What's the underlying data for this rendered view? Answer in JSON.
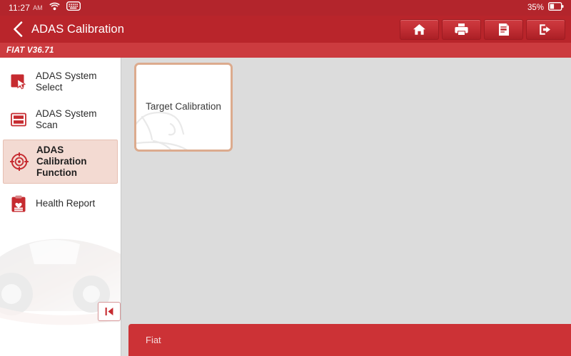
{
  "statusbar": {
    "time": "11:27",
    "ampm": "AM",
    "wifi_icon": "wifi-icon",
    "keyboard_icon": "keyboard-icon",
    "battery_percent": "35%",
    "battery_icon": "battery-icon"
  },
  "header": {
    "back_icon": "back-chevron-icon",
    "title": "ADAS Calibration",
    "toolbar": [
      {
        "name": "home-button",
        "icon": "home-icon"
      },
      {
        "name": "print-button",
        "icon": "printer-icon"
      },
      {
        "name": "adas-report-button",
        "icon": "adas-report-icon"
      },
      {
        "name": "exit-button",
        "icon": "exit-icon"
      }
    ]
  },
  "subbar": {
    "version_text": "FIAT V36.71"
  },
  "sidebar": {
    "items": [
      {
        "label": "ADAS System Select",
        "icon": "cursor-select-icon",
        "selected": false
      },
      {
        "label": "ADAS System Scan",
        "icon": "scan-layers-icon",
        "selected": false
      },
      {
        "label": "ADAS Calibration Function",
        "icon": "target-crosshair-icon",
        "selected": true
      },
      {
        "label": "Health Report",
        "icon": "clipboard-heart-icon",
        "selected": false
      }
    ],
    "collapse_button": {
      "name": "collapse-sidebar-button",
      "icon": "skip-to-start-icon"
    },
    "watermark": "car-watermark"
  },
  "content": {
    "cards": [
      {
        "label": "Target Calibration",
        "watermark": "car-outline-watermark"
      }
    ]
  },
  "bottombar": {
    "vehicle": "Fiat"
  },
  "colors": {
    "status_bar_red": "#b3252c",
    "header_red": "#b9252b",
    "subbar_red": "#cc3b3f",
    "bottom_bar_red": "#cc3236",
    "content_bg": "#dcdcdc",
    "sidebar_bg": "#ffffff",
    "selected_item_bg": "#f3dad2",
    "card_border": "#dcab8e",
    "icon_red": "#c62b30"
  }
}
